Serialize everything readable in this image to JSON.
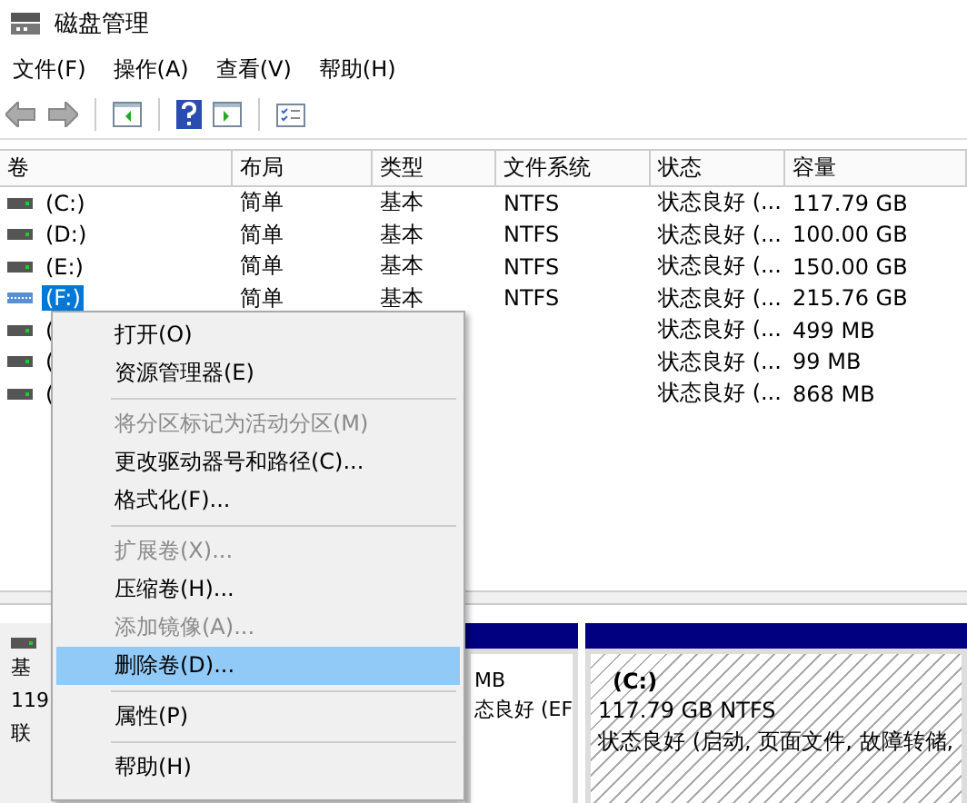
{
  "window": {
    "title": "磁盘管理"
  },
  "menu_bar": [
    "文件(F)",
    "操作(A)",
    "查看(V)",
    "帮助(H)"
  ],
  "table": {
    "columns": [
      "卷",
      "布局",
      "类型",
      "文件系统",
      "状态",
      "容量"
    ],
    "rows": [
      {
        "cells": [
          "(C:)",
          "简单",
          "基本",
          "NTFS",
          "状态良好 (...",
          "117.79 GB"
        ],
        "selected": false,
        "kind": "basic"
      },
      {
        "cells": [
          "(D:)",
          "简单",
          "基本",
          "NTFS",
          "状态良好 (...",
          "100.00 GB"
        ],
        "selected": false,
        "kind": "basic"
      },
      {
        "cells": [
          "(E:)",
          "简单",
          "基本",
          "NTFS",
          "状态良好 (...",
          "150.00 GB"
        ],
        "selected": false,
        "kind": "basic"
      },
      {
        "cells": [
          "(F:)",
          "简单",
          "基本",
          "NTFS",
          "状态良好 (...",
          "215.76 GB"
        ],
        "selected": true,
        "kind": "striped"
      },
      {
        "cells": [
          "(",
          "",
          "",
          "",
          "状态良好 (...",
          "499 MB"
        ],
        "selected": false,
        "kind": "basic"
      },
      {
        "cells": [
          "(",
          "",
          "",
          "",
          "状态良好 (...",
          "99 MB"
        ],
        "selected": false,
        "kind": "basic"
      },
      {
        "cells": [
          "(",
          "",
          "",
          "",
          "状态良好 (...",
          "868 MB"
        ],
        "selected": false,
        "kind": "basic"
      }
    ]
  },
  "disk": {
    "lines": [
      "基",
      "119",
      "联"
    ],
    "partitions": [
      {
        "kind": "plain",
        "lines": [
          "MB",
          "态良好 (EF"
        ]
      },
      {
        "kind": "hatched",
        "name": "(C:)",
        "lines": [
          "117.79 GB NTFS",
          "状态良好 (启动, 页面文件, 故障转储,"
        ]
      }
    ]
  },
  "context_menu": [
    {
      "kind": "item",
      "label": "打开(O)",
      "disabled": false,
      "selected": false
    },
    {
      "kind": "item",
      "label": "资源管理器(E)",
      "disabled": false,
      "selected": false
    },
    {
      "kind": "separator"
    },
    {
      "kind": "item",
      "label": "将分区标记为活动分区(M)",
      "disabled": true,
      "selected": false
    },
    {
      "kind": "item",
      "label": "更改驱动器号和路径(C)...",
      "disabled": false,
      "selected": false
    },
    {
      "kind": "item",
      "label": "格式化(F)...",
      "disabled": false,
      "selected": false
    },
    {
      "kind": "separator"
    },
    {
      "kind": "item",
      "label": "扩展卷(X)...",
      "disabled": true,
      "selected": false
    },
    {
      "kind": "item",
      "label": "压缩卷(H)...",
      "disabled": false,
      "selected": false
    },
    {
      "kind": "item",
      "label": "添加镜像(A)...",
      "disabled": true,
      "selected": false
    },
    {
      "kind": "item",
      "label": "删除卷(D)...",
      "disabled": false,
      "selected": true
    },
    {
      "kind": "separator"
    },
    {
      "kind": "item",
      "label": "属性(P)",
      "disabled": false,
      "selected": false
    },
    {
      "kind": "separator"
    },
    {
      "kind": "item",
      "label": "帮助(H)",
      "disabled": false,
      "selected": false
    }
  ]
}
